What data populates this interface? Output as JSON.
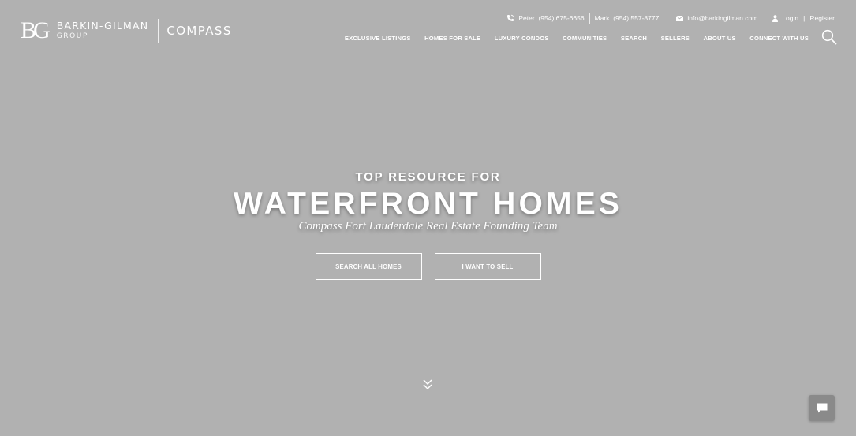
{
  "brand": {
    "monogram": "BG",
    "name": "BARKIN-GILMAN",
    "group": "GROUP",
    "partner": "COMPASS"
  },
  "contact": {
    "peter_name": "Peter",
    "peter_phone": "(954) 675-6656",
    "mark_name": "Mark",
    "mark_phone": "(954) 557-8777",
    "email": "info@barkingilman.com",
    "login": "Login",
    "separator": "|",
    "register": "Register"
  },
  "nav": {
    "items": [
      "EXCLUSIVE LISTINGS",
      "HOMES FOR SALE",
      "LUXURY CONDOS",
      "COMMUNITIES",
      "SEARCH",
      "SELLERS",
      "ABOUT US",
      "CONNECT WITH US"
    ]
  },
  "hero": {
    "kicker": "TOP RESOURCE FOR",
    "headline": "WATERFRONT HOMES",
    "tagline": "Compass Fort Lauderdale Real Estate Founding Team",
    "search_button": "SEARCH ALL HOMES",
    "sell_button": "I WANT TO SELL"
  },
  "icons": {
    "phone": "phone-icon",
    "email": "envelope-icon",
    "user": "user-icon",
    "search": "search-icon",
    "scroll": "double-chevron-down-icon",
    "chat": "chat-bubble-icon"
  },
  "colors": {
    "background": "#b1b1b1",
    "text": "#ffffff",
    "chat_button": "#8a8a8a"
  }
}
